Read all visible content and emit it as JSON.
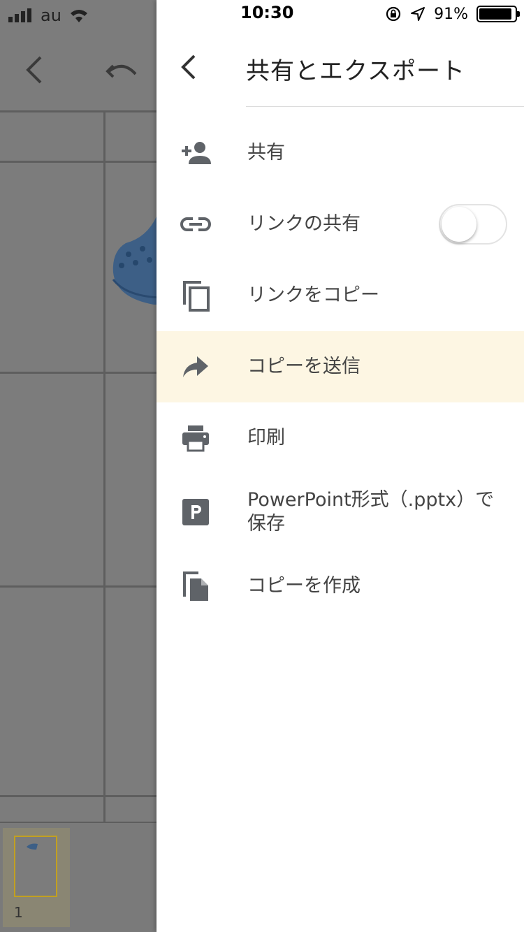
{
  "status": {
    "carrier": "au",
    "time": "10:30",
    "battery": "91%",
    "battery_level": 0.91
  },
  "background": {
    "thumbnail_page_number": "1"
  },
  "drawer": {
    "title": "共有とエクスポート",
    "items": [
      {
        "label": "共有",
        "icon": "add-person-icon"
      },
      {
        "label": "リンクの共有",
        "icon": "link-icon",
        "toggle_on": false
      },
      {
        "label": "リンクをコピー",
        "icon": "copy-icon"
      },
      {
        "label": "コピーを送信",
        "icon": "forward-arrow-icon",
        "highlighted": true
      },
      {
        "label": "印刷",
        "icon": "print-icon"
      },
      {
        "label": "PowerPoint形式（.pptx）で保存",
        "icon": "powerpoint-icon"
      },
      {
        "label": "コピーを作成",
        "icon": "document-copy-icon"
      }
    ]
  },
  "colors": {
    "highlight": "#fdf6e3",
    "icon": "#5f6368",
    "text": "#444444",
    "overlay": "#7c7c7c"
  }
}
